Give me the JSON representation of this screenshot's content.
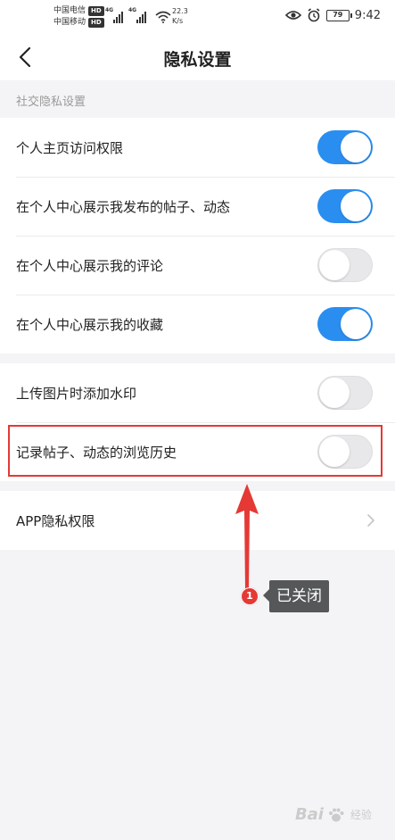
{
  "status_bar": {
    "carrier_1": "中国电信",
    "carrier_2": "中国移动",
    "hd_badge": "HD",
    "network_gen": "4G",
    "net_speed_value": "22.3",
    "net_speed_unit": "K/s",
    "battery_level": "79",
    "time": "9:42",
    "icons": [
      "signal-icon",
      "wifi-icon",
      "eye-icon",
      "alarm-icon",
      "battery-icon"
    ]
  },
  "header": {
    "title": "隐私设置",
    "back_icon": "chevron-left-icon"
  },
  "social_privacy": {
    "section_title": "社交隐私设置",
    "items": [
      {
        "label": "个人主页访问权限",
        "enabled": true
      },
      {
        "label": "在个人中心展示我发布的帖子、动态",
        "enabled": true
      },
      {
        "label": "在个人中心展示我的评论",
        "enabled": false
      },
      {
        "label": "在个人中心展示我的收藏",
        "enabled": true
      }
    ]
  },
  "content_settings": {
    "items": [
      {
        "label": "上传图片时添加水印",
        "enabled": false
      },
      {
        "label": "记录帖子、动态的浏览历史",
        "enabled": false
      }
    ]
  },
  "app_privacy": {
    "label": "APP隐私权限",
    "icon": "chevron-right-icon"
  },
  "annotation": {
    "number": "1",
    "text": "已关闭"
  },
  "watermark": {
    "text": "Bai",
    "suffix": "经验"
  },
  "colors": {
    "toggle_on": "#2a8ef0",
    "toggle_off": "#e8e8ea",
    "highlight": "#e53935",
    "annotation_bg": "#555759",
    "page_bg": "#f4f4f6"
  }
}
